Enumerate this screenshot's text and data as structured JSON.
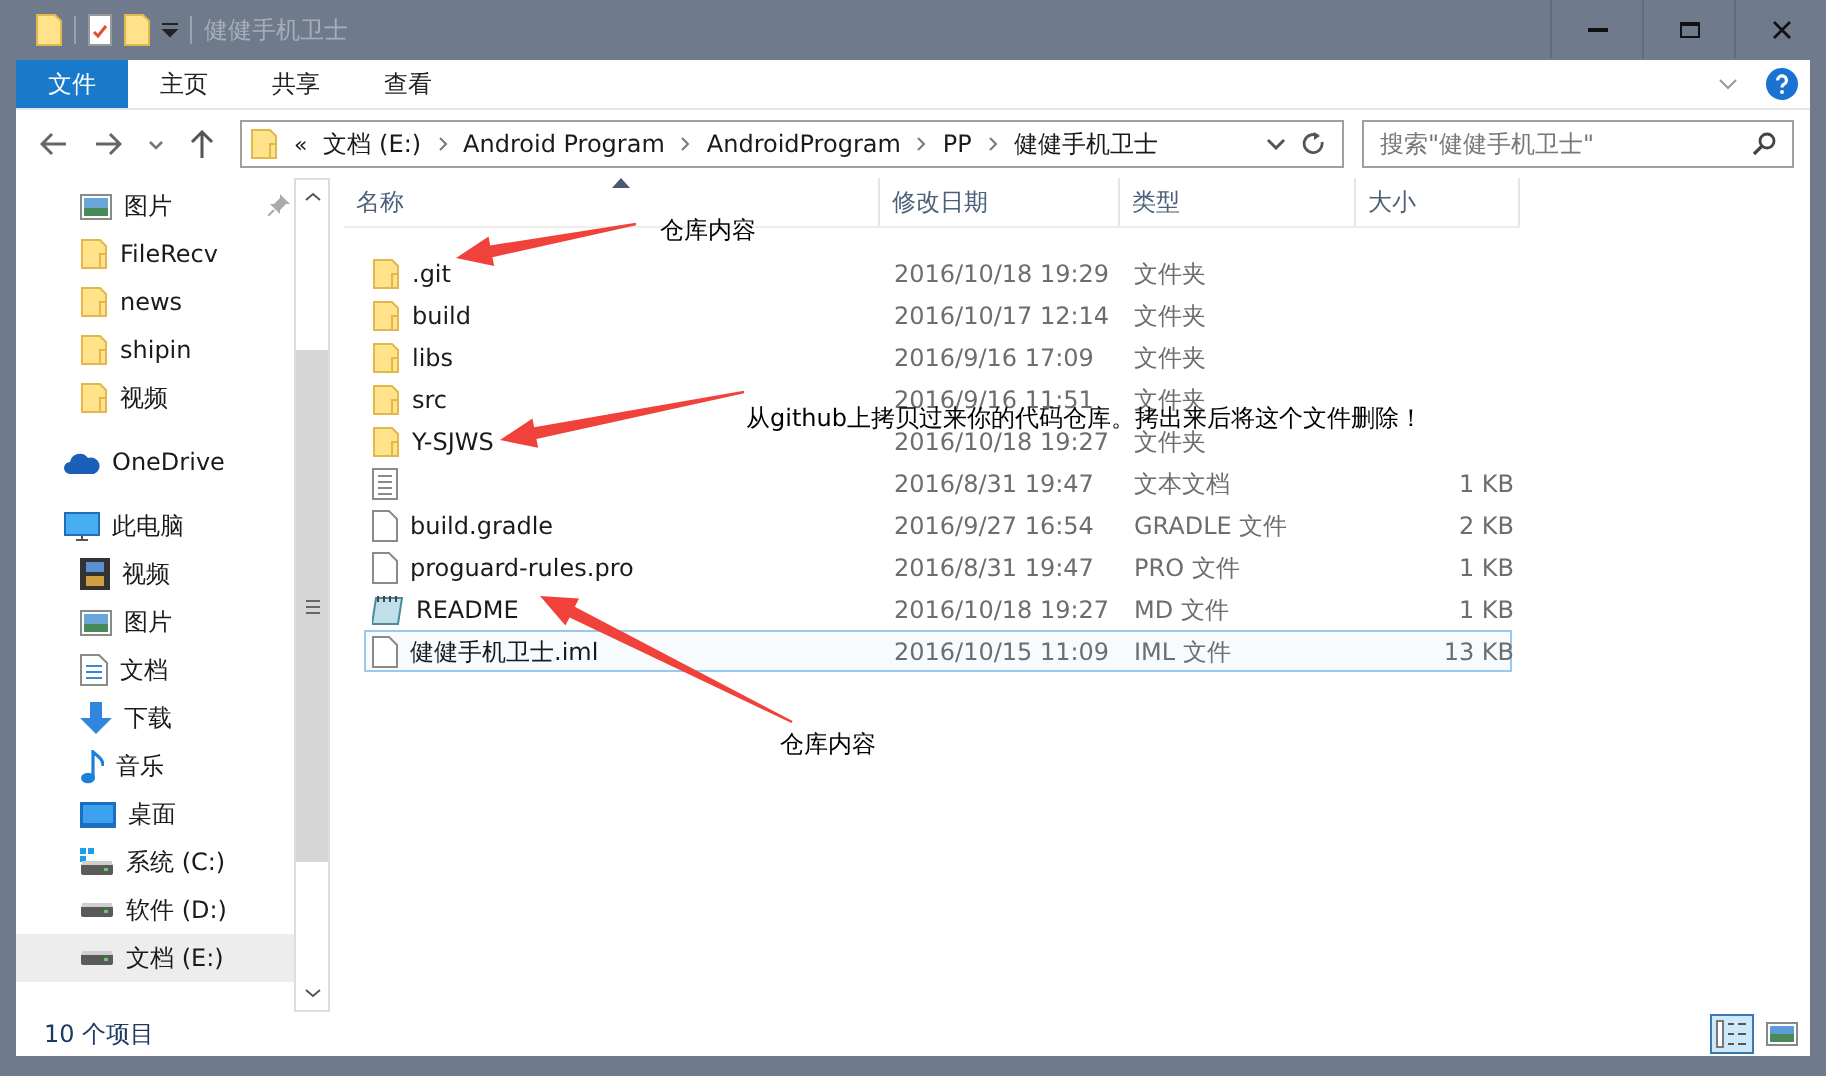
{
  "window": {
    "title": "健健手机卫士"
  },
  "ribbon_tabs": [
    {
      "label": "文件",
      "kind": "file"
    },
    {
      "label": "主页",
      "kind": "tab"
    },
    {
      "label": "共享",
      "kind": "tab"
    },
    {
      "label": "查看",
      "kind": "tab"
    }
  ],
  "address": {
    "overflow": "«",
    "crumbs": [
      "文档 (E:)",
      "Android Program",
      "AndroidProgram",
      "PP",
      "健健手机卫士"
    ]
  },
  "search": {
    "placeholder": "搜索\"健健手机卫士\""
  },
  "sidebar": {
    "quick_access": [
      {
        "label": "图片",
        "kind": "pictures",
        "pinned": true
      },
      {
        "label": "FileRecv",
        "kind": "folder",
        "pinned": false
      },
      {
        "label": "news",
        "kind": "folder",
        "pinned": false
      },
      {
        "label": "shipin",
        "kind": "folder",
        "pinned": false
      },
      {
        "label": "视频",
        "kind": "folder",
        "pinned": false
      }
    ],
    "onedrive": {
      "label": "OneDrive"
    },
    "this_pc": {
      "label": "此电脑",
      "children": [
        {
          "label": "视频",
          "kind": "video",
          "selected": false
        },
        {
          "label": "图片",
          "kind": "pictures",
          "selected": false
        },
        {
          "label": "文档",
          "kind": "document",
          "selected": false
        },
        {
          "label": "下载",
          "kind": "download",
          "selected": false
        },
        {
          "label": "音乐",
          "kind": "music",
          "selected": false
        },
        {
          "label": "桌面",
          "kind": "desktop",
          "selected": false
        },
        {
          "label": "系统 (C:)",
          "kind": "system-drive",
          "selected": false
        },
        {
          "label": "软件 (D:)",
          "kind": "drive",
          "selected": false
        },
        {
          "label": "文档 (E:)",
          "kind": "drive",
          "selected": true
        }
      ]
    }
  },
  "table": {
    "columns": [
      "名称",
      "修改日期",
      "类型",
      "大小"
    ],
    "rows": [
      {
        "name": ".git",
        "date": "2016/10/18 19:29",
        "type": "文件夹",
        "kind": "folder",
        "selected": false
      },
      {
        "name": "build",
        "date": "2016/10/17 12:14",
        "type": "文件夹",
        "kind": "folder",
        "selected": false
      },
      {
        "name": "libs",
        "date": "2016/9/16 17:09",
        "type": "文件夹",
        "kind": "folder",
        "selected": false
      },
      {
        "name": "src",
        "date": "2016/9/16 11:51",
        "type": "文件夹",
        "kind": "folder",
        "selected": false
      },
      {
        "name": "Y-SJWS",
        "date": "2016/10/18 19:27",
        "type": "文件夹",
        "kind": "folder",
        "selected": false
      },
      {
        "date": "2016/8/31 19:47",
        "type": "文本文档",
        "size": "1 KB",
        "kind": "text",
        "selected": false
      },
      {
        "name": "build.gradle",
        "date": "2016/9/27 16:54",
        "type": "GRADLE 文件",
        "size": "2 KB",
        "kind": "file",
        "selected": false
      },
      {
        "name": "proguard-rules.pro",
        "date": "2016/8/31 19:47",
        "type": "PRO 文件",
        "size": "1 KB",
        "kind": "file",
        "selected": false
      },
      {
        "name": "README",
        "date": "2016/10/18 19:27",
        "type": "MD 文件",
        "size": "1 KB",
        "kind": "notepad",
        "selected": false
      },
      {
        "name": "健健手机卫士.iml",
        "date": "2016/10/15 11:09",
        "type": "IML 文件",
        "size": "13 KB",
        "kind": "file",
        "selected": true
      }
    ]
  },
  "annotations": [
    "仓库内容",
    "从github上拷贝过来你的代码仓库。拷出来后将这个文件删除！",
    "仓库内容"
  ],
  "status_bar": {
    "item_count": "10 个项目",
    "views": [
      {
        "kind": "details",
        "selected": true
      },
      {
        "kind": "large-icons",
        "selected": false
      }
    ]
  }
}
